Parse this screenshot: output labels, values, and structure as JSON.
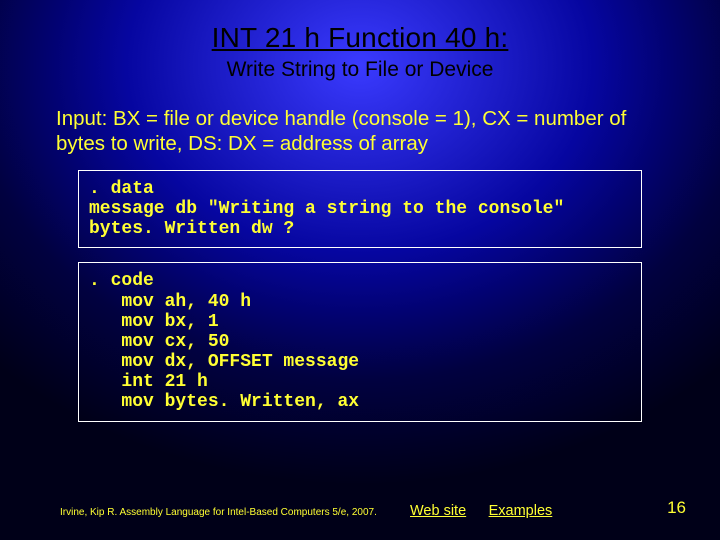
{
  "title": "INT 21 h Function 40 h:",
  "subtitle": "Write String to File or Device",
  "input_description": "Input: BX = file or device handle (console = 1), CX = number of bytes to write, DS: DX = address of array",
  "code_block_1": ". data\nmessage db \"Writing a string to the console\"\nbytes. Written dw ?",
  "code_block_2": ". code\n   mov ah, 40 h\n   mov bx, 1\n   mov cx, 50\n   mov dx, OFFSET message\n   int 21 h\n   mov bytes. Written, ax",
  "footer": {
    "citation": "Irvine, Kip R. Assembly Language for Intel-Based Computers 5/e, 2007.",
    "link_web": "Web site",
    "link_examples": "Examples",
    "page_number": "16"
  }
}
